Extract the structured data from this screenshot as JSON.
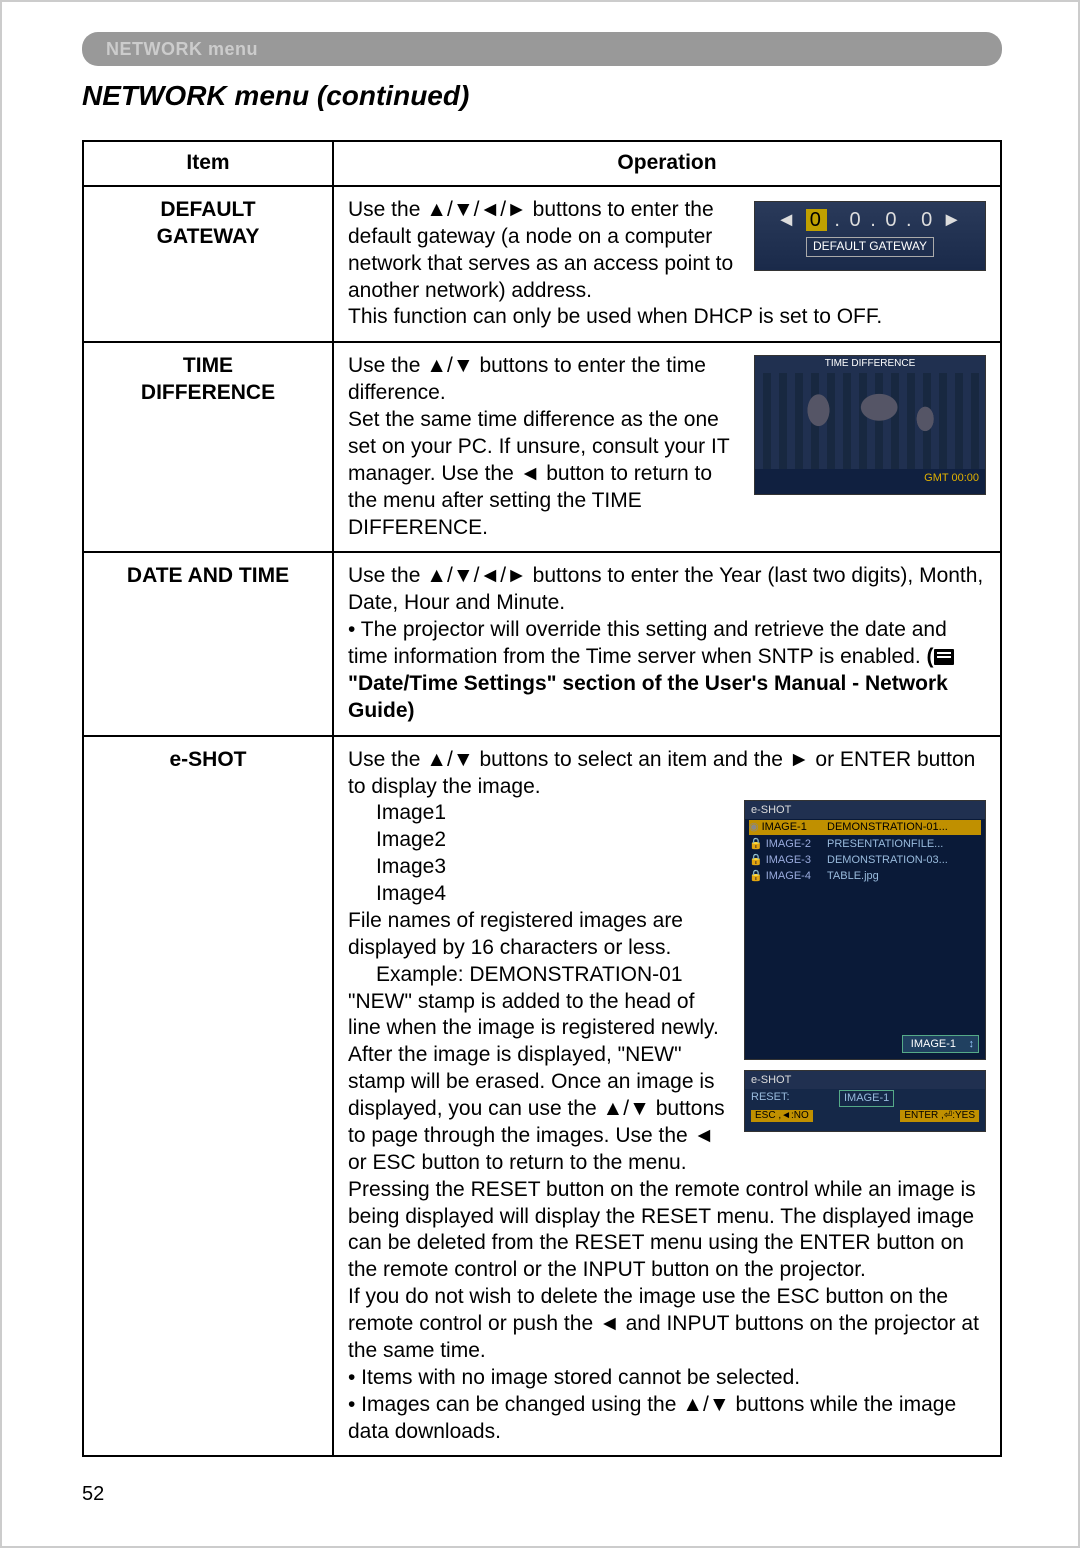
{
  "tab": {
    "label": "NETWORK menu"
  },
  "title": "NETWORK menu (continued)",
  "headers": {
    "item": "Item",
    "operation": "Operation"
  },
  "rows": {
    "gateway": {
      "item": "DEFAULT\nGATEWAY",
      "p1": "Use the ▲/▼/◄/► buttons to enter the default gateway (a node on a computer network that serves as an access point to another network) address.",
      "p2": "This function can only be used when DHCP is set to OFF.",
      "shot": {
        "ip_hl": "0",
        "ip_rest": " .  0  .  0  .  0",
        "label": "DEFAULT GATEWAY"
      }
    },
    "time": {
      "item": "TIME\nDIFFERENCE",
      "p1": "Use the ▲/▼ buttons to enter the time difference.",
      "p2": "Set the same time difference as the one set on your PC. If unsure, consult your IT manager. Use the ◄ button to return to the menu after setting the TIME DIFFERENCE.",
      "shot": {
        "hdr": "TIME DIFFERENCE",
        "gmt": "GMT 00:00"
      }
    },
    "datetime": {
      "item": "DATE AND TIME",
      "p1": "Use the ▲/▼/◄/► buttons to enter the Year (last two digits), Month, Date, Hour and Minute.",
      "p2": "• The projector will override this setting and retrieve the date and time information from the Time server when SNTP is enabled. ",
      "p3": "(",
      "p4": " \"Date/Time Settings\" section of the User's Manual - Network Guide)"
    },
    "eshot": {
      "item": "e-SHOT",
      "p1": "Use the ▲/▼ buttons to select an item and the ► or ENTER button to display the image.",
      "img1": "Image1",
      "img2": "Image2",
      "img3": "Image3",
      "img4": "Image4",
      "p2": "File names of registered images are displayed by 16 characters or less.",
      "ex": "Example: DEMONSTRATION-01",
      "p3": "\"NEW\" stamp is added to the head of line when the image is registered newly. After the image is displayed, \"NEW\" stamp will be erased. Once an image is displayed, you can use the ▲/▼ buttons to page through the images. Use the ◄ or ESC button to return to the menu.",
      "p4": "Pressing the RESET button on the remote control while an image is being displayed will display the RESET menu. The displayed image can be deleted from the RESET menu using the ENTER button on the remote control or the INPUT button on the projector.",
      "p5": "If you do not wish to delete the image use the ESC button on the remote control or push the ◄ and INPUT buttons on the projector at the same time.",
      "p6": "• Items with no image stored cannot be selected.",
      "p7": "• Images can be changed using the ▲/▼ buttons while the image data downloads.",
      "shot1": {
        "hdr": "e-SHOT",
        "r1a": "IMAGE-1",
        "r1b": "DEMONSTRATION-01...",
        "r2a": "IMAGE-2",
        "r2b": "PRESENTATIONFILE...",
        "r3a": "IMAGE-3",
        "r3b": "DEMONSTRATION-03...",
        "r4a": "IMAGE-4",
        "r4b": "TABLE.jpg",
        "tag": "IMAGE-1"
      },
      "shot2": {
        "hdr": "e-SHOT",
        "r1a": "RESET:",
        "r1b": "IMAGE-1",
        "no": "ESC ,◄:NO",
        "yes": "ENTER ,⏎:YES"
      }
    }
  },
  "page_number": "52"
}
